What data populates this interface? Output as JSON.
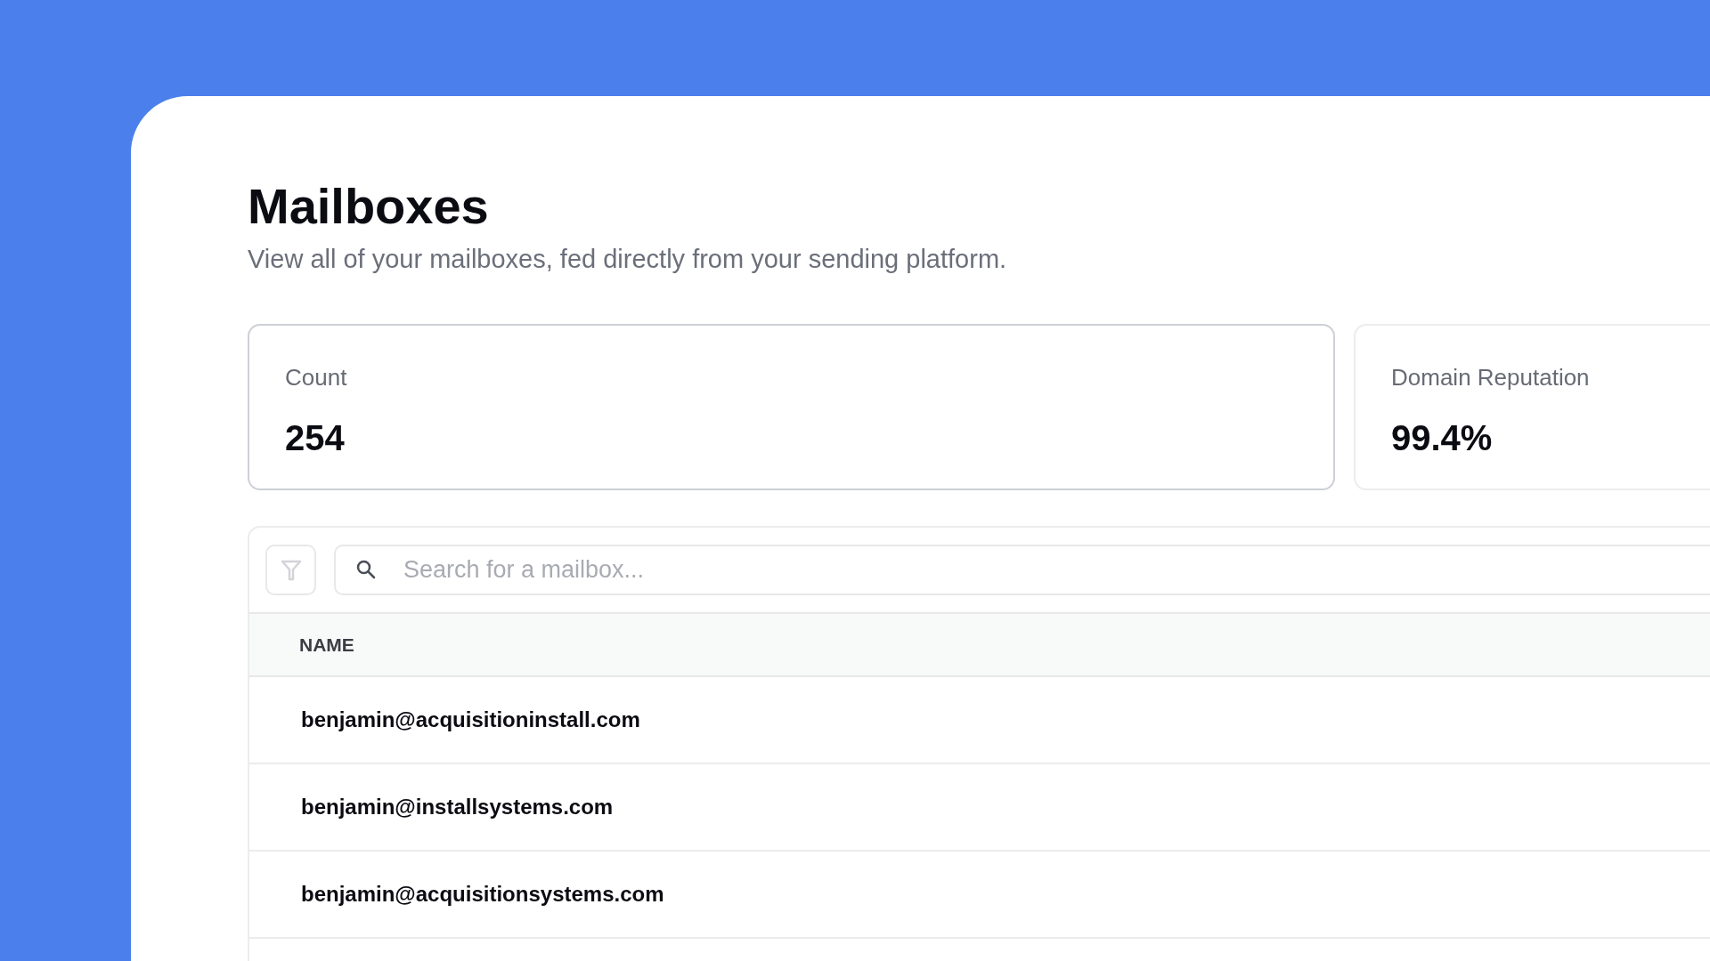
{
  "page": {
    "title": "Mailboxes",
    "subtitle": "View all of your mailboxes, fed directly from your sending platform."
  },
  "stats": [
    {
      "label": "Count",
      "value": "254",
      "selected": true
    },
    {
      "label": "Domain Reputation",
      "value": "99.4%",
      "selected": false
    }
  ],
  "search": {
    "placeholder": "Search for a mailbox..."
  },
  "table": {
    "columns": [
      "NAME"
    ],
    "rows": [
      [
        "benjamin@acquisitioninstall.com"
      ],
      [
        "benjamin@installsystems.com"
      ],
      [
        "benjamin@acquisitionsystems.com"
      ]
    ]
  }
}
